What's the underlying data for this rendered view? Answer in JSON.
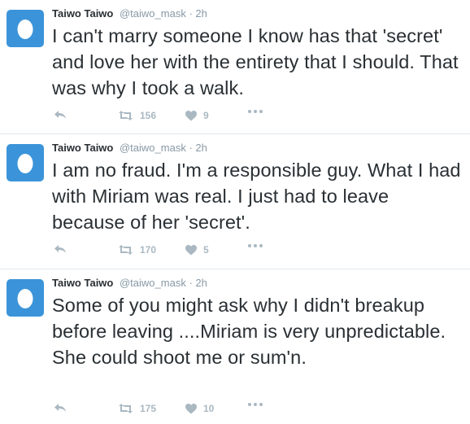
{
  "colors": {
    "avatar_bg": "#3b94d9",
    "text": "#292f33",
    "muted": "#8899a6",
    "action": "#aab8c2",
    "divider": "#e1e8ed"
  },
  "tweets": [
    {
      "fullname": "Taiwo Taiwo",
      "username": "@taiwo_mask",
      "separator": "·",
      "time": "2h",
      "text": "I can't marry someone I know has that 'secret' and love her with the entirety that I should. That was why I took a walk.",
      "retweets": "156",
      "likes": "9",
      "icons": [
        "egg-avatar-icon",
        "reply-icon",
        "retweet-icon",
        "heart-icon",
        "more-icon"
      ]
    },
    {
      "fullname": "Taiwo Taiwo",
      "username": "@taiwo_mask",
      "separator": "·",
      "time": "2h",
      "text": "I am no fraud. I'm a responsible guy. What I had with Miriam was real. I just had to leave because of her 'secret'.",
      "retweets": "170",
      "likes": "5",
      "icons": [
        "egg-avatar-icon",
        "reply-icon",
        "retweet-icon",
        "heart-icon",
        "more-icon"
      ]
    },
    {
      "fullname": "Taiwo Taiwo",
      "username": "@taiwo_mask",
      "separator": "·",
      "time": "2h",
      "text": "Some of you might ask why I didn't breakup before leaving ....Miriam is very unpredictable. She could shoot me or sum'n.",
      "retweets": "175",
      "likes": "10",
      "icons": [
        "egg-avatar-icon",
        "reply-icon",
        "retweet-icon",
        "heart-icon",
        "more-icon"
      ]
    }
  ]
}
